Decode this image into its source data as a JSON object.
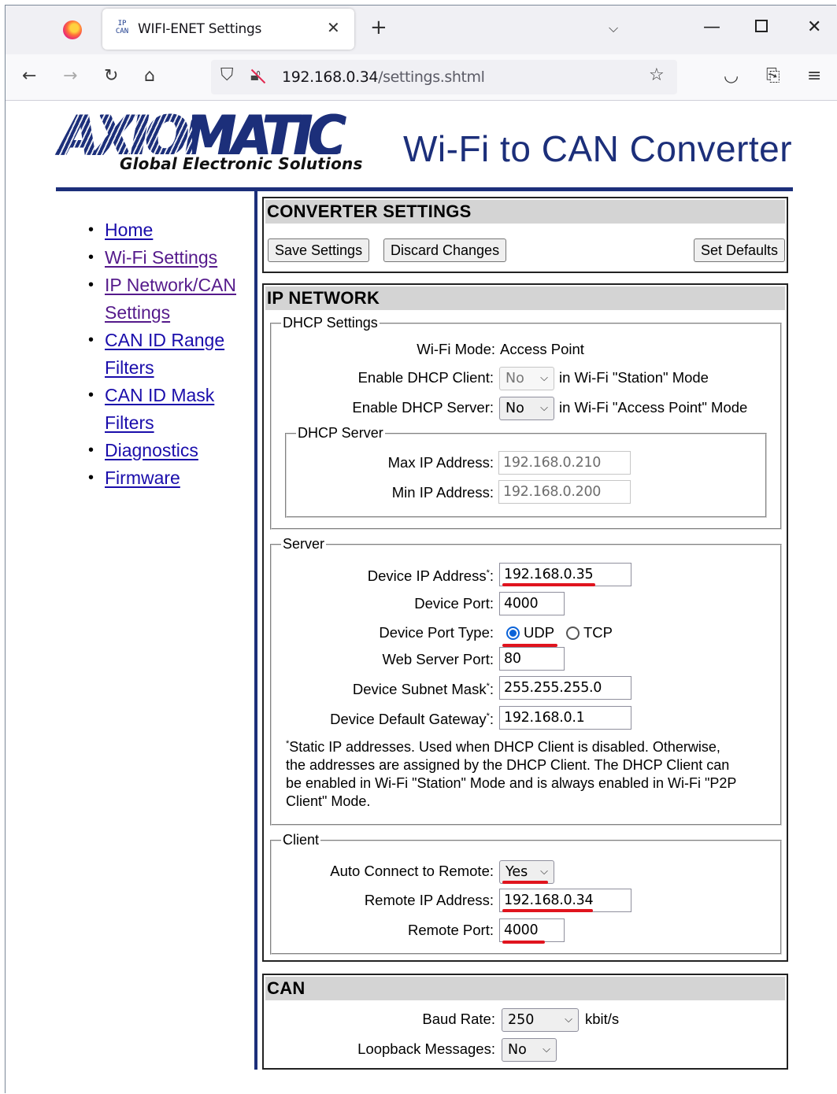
{
  "browser": {
    "tab_title": "WIFI-ENET Settings",
    "tab_favicon_text": "IP\nCAN",
    "url_host": "192.168.0.34",
    "url_path": "/settings.shtml",
    "icons": [
      "firefox-logo",
      "close-icon",
      "plus-icon",
      "chevron-down-icon",
      "minimize-icon",
      "maximize-icon",
      "close-window-icon",
      "back-arrow-icon",
      "forward-arrow-icon",
      "reload-icon",
      "home-icon",
      "shield-icon",
      "lock-icon",
      "star-icon",
      "pocket-icon",
      "extensions-icon",
      "menu-icon"
    ]
  },
  "header": {
    "logo_word": "AXIOMATIC",
    "logo_tagline": "Global Electronic Solutions",
    "title": "Wi-Fi to CAN Converter",
    "brand_color": "#1c2f7a"
  },
  "sidebar": {
    "items": [
      {
        "label": "Home"
      },
      {
        "label": "Wi-Fi Settings"
      },
      {
        "label": "IP Network/CAN Settings"
      },
      {
        "label": "CAN ID Range Filters"
      },
      {
        "label": "CAN ID Mask Filters"
      },
      {
        "label": "Diagnostics"
      },
      {
        "label": "Firmware"
      }
    ]
  },
  "converter": {
    "heading": "CONVERTER SETTINGS",
    "save_label": "Save Settings",
    "discard_label": "Discard Changes",
    "defaults_label": "Set Defaults"
  },
  "ip_network": {
    "heading": "IP NETWORK",
    "dhcp": {
      "legend": "DHCP Settings",
      "wifi_mode_label": "Wi-Fi Mode:",
      "wifi_mode_value": "Access Point",
      "client_label": "Enable DHCP Client:",
      "client_value": "No",
      "client_suffix": "in Wi-Fi \"Station\" Mode",
      "server_label": "Enable DHCP Server:",
      "server_value": "No",
      "server_suffix": "in Wi-Fi \"Access Point\" Mode",
      "server_box": {
        "legend": "DHCP Server",
        "max_label": "Max IP Address:",
        "max_value": "192.168.0.210",
        "min_label": "Min IP Address:",
        "min_value": "192.168.0.200"
      }
    },
    "server": {
      "legend": "Server",
      "device_ip_label": "Device IP Address",
      "device_ip_value": "192.168.0.35",
      "device_port_label": "Device Port:",
      "device_port_value": "4000",
      "port_type_label": "Device Port Type:",
      "port_type_options": [
        "UDP",
        "TCP"
      ],
      "port_type_selected": "UDP",
      "web_port_label": "Web Server Port:",
      "web_port_value": "80",
      "subnet_label": "Device Subnet Mask",
      "subnet_value": "255.255.255.0",
      "gateway_label": "Device Default Gateway",
      "gateway_value": "192.168.0.1",
      "asterisk": "*",
      "colon": ":",
      "note_line1": "Static IP addresses. Used when DHCP Client is disabled. Otherwise,",
      "note_line2": "the addresses are assigned by the DHCP Client. The DHCP Client can",
      "note_line3": "be enabled in Wi-Fi \"Station\" Mode and is always enabled in Wi-Fi \"P2P",
      "note_line4": "Client\" Mode."
    },
    "client": {
      "legend": "Client",
      "auto_label": "Auto Connect to Remote:",
      "auto_value": "Yes",
      "remote_ip_label": "Remote IP Address:",
      "remote_ip_value": "192.168.0.34",
      "remote_port_label": "Remote Port:",
      "remote_port_value": "4000"
    }
  },
  "can": {
    "heading": "CAN",
    "baud_label": "Baud Rate:",
    "baud_value": "250",
    "baud_unit": "kbit/s",
    "loopback_label": "Loopback Messages:",
    "loopback_value": "No"
  },
  "annotation_color": "#e0141e"
}
